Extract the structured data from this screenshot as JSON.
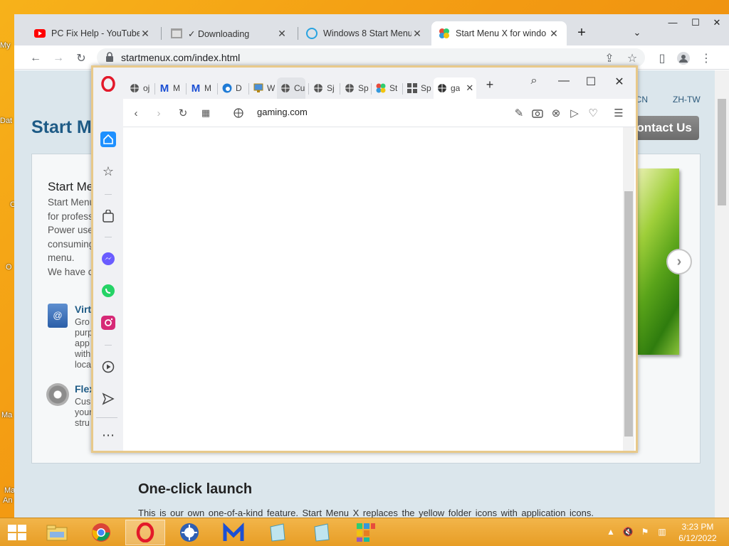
{
  "desktop": {
    "icons": [
      {
        "label": "My"
      },
      {
        "label": "Dat"
      },
      {
        "label": "C"
      },
      {
        "label": "O"
      },
      {
        "label": "Ma"
      },
      {
        "label": "Ma"
      },
      {
        "label": "An"
      }
    ]
  },
  "chrome": {
    "tabs": [
      {
        "label": "PC Fix Help - YouTube",
        "icon": "youtube-icon"
      },
      {
        "label": "✓ Downloading",
        "icon": "download-page-icon"
      },
      {
        "label": "Windows 8 Start Menu",
        "icon": "windows8-startmenu-icon"
      },
      {
        "label": "Start Menu X for windo",
        "icon": "startmenux-icon"
      }
    ],
    "new_tab": "+",
    "url": "startmenux.com/index.html",
    "window_controls": {
      "minimize": "—",
      "maximize": "☐",
      "close": "✕"
    }
  },
  "page": {
    "title": "Start M",
    "contact": "Contact Us",
    "langs": [
      "H-CN",
      "ZH-TW"
    ],
    "card": {
      "heading": "Start Me",
      "lines": [
        "Start Menu",
        "for profess",
        "Power use",
        "consuming",
        "menu.",
        "We have c"
      ]
    },
    "features": [
      {
        "title": "Virt",
        "lines": [
          "Gro",
          "purp",
          "app",
          "with",
          "loca"
        ]
      },
      {
        "title": "Flex",
        "lines": [
          "Cus",
          "your",
          "stru"
        ]
      }
    ],
    "oneclick": {
      "title": "One-click launch",
      "text": "This is our own one-of-a-kind feature. Start Menu X replaces the yellow folder icons with application icons. Clicking on the folder launches the application. To access a submenu, hover the cursor over a folder for a few"
    }
  },
  "opera": {
    "tabs": [
      {
        "label": "oj",
        "icon": "globe-icon"
      },
      {
        "label": "M",
        "icon": "malwarebytes-icon"
      },
      {
        "label": "M",
        "icon": "malwarebytes-icon"
      },
      {
        "label": "D",
        "icon": "edge-icon"
      },
      {
        "label": "W",
        "icon": "monitor-icon"
      },
      {
        "label": "Cu",
        "icon": "globe-icon"
      },
      {
        "label": "Sj",
        "icon": "globe-icon"
      },
      {
        "label": "Sp",
        "icon": "globe-icon"
      },
      {
        "label": "St",
        "icon": "startmenux-icon"
      },
      {
        "label": "Sp",
        "icon": "windows-grid-icon"
      },
      {
        "label": "ga",
        "icon": "globe-icon"
      }
    ],
    "url": "gaming.com",
    "new_tab": "+"
  },
  "taskbar": {
    "time": "3:23 PM",
    "date": "6/12/2022"
  }
}
